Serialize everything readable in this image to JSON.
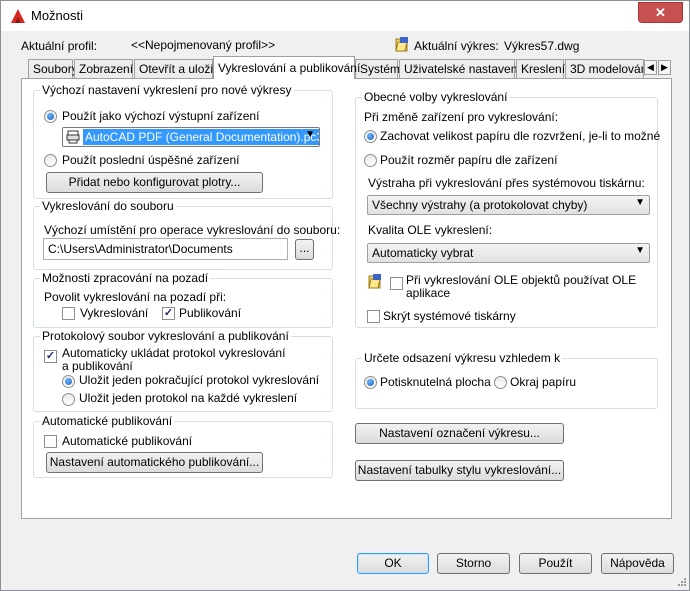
{
  "window": {
    "title": "Možnosti",
    "close_glyph": "✕"
  },
  "profile": {
    "label": "Aktuální profil:",
    "value": "<<Nepojmenovaný profil>>",
    "drawing_label": "Aktuální výkres:",
    "drawing_value": "Výkres57.dwg"
  },
  "tabs": [
    {
      "label": "Soubory"
    },
    {
      "label": "Zobrazení"
    },
    {
      "label": "Otevřít a uložit"
    },
    {
      "label": "Vykreslování a publikování"
    },
    {
      "label": "Systém"
    },
    {
      "label": "Uživatelské nastavení"
    },
    {
      "label": "Kreslení"
    },
    {
      "label": "3D modelování"
    }
  ],
  "tab_scroll": {
    "left": "◀",
    "right": "▶"
  },
  "left": {
    "default_output": {
      "title": "Výchozí nastavení vykreslení pro nové výkresy",
      "use_default_label": "Použít jako výchozí výstupní zařízení",
      "device_value": "AutoCAD PDF (General Documentation).pc3",
      "use_last_label": "Použít poslední úspěšné zařízení",
      "add_plotters_button": "Přidat nebo konfigurovat plotry..."
    },
    "plot_to_file": {
      "title": "Vykreslování do souboru",
      "location_label": "Výchozí umístění pro operace vykreslování do souboru:",
      "path_value": "C:\\Users\\Administrator\\Documents",
      "browse_button": "..."
    },
    "background": {
      "title": "Možnosti zpracování na pozadí",
      "enable_label": "Povolit vykreslování na pozadí při:",
      "plotting_label": "Vykreslování",
      "publishing_label": "Publikování"
    },
    "log": {
      "title": "Protokolový soubor vykreslování a publikování",
      "auto_save_label": "Automaticky ukládat protokol vykreslování a publikování",
      "one_continuous_label": "Uložit jeden pokračující protokol vykreslování",
      "one_per_plot_label": "Uložit jeden protokol na každé vykreslení"
    },
    "auto_publish": {
      "title": "Automatické publikování",
      "checkbox_label": "Automatické publikování",
      "settings_button": "Nastavení automatického publikování..."
    }
  },
  "right": {
    "general": {
      "title": "Obecné volby vykreslování",
      "device_change_label": "Při změně zařízení pro vykreslování:",
      "keep_layout_label": "Zachovat velikost papíru dle rozvržení, je-li to možné",
      "use_device_label": "Použít rozměr papíru dle zařízení",
      "system_alert_label": "Výstraha při vykreslování přes systémovou tiskárnu:",
      "alert_value": "Všechny výstrahy (a protokolovat chyby)",
      "ole_quality_label": "Kvalita OLE vykreslení:",
      "ole_value": "Automaticky vybrat",
      "ole_app_label": "Při vykreslování OLE objektů používat OLE aplikace",
      "hide_printers_label": "Skrýt systémové tiskárny"
    },
    "offset": {
      "title": "Určete odsazení výkresu vzhledem k",
      "printable_label": "Potisknutelná plocha",
      "paper_edge_label": "Okraj papíru"
    },
    "stamp_button": "Nastavení označení výkresu...",
    "plot_style_button": "Nastavení tabulky stylu vykreslování..."
  },
  "footer": {
    "ok": "OK",
    "cancel": "Storno",
    "apply": "Použít",
    "help": "Nápověda"
  },
  "colors": {
    "accent": "#3399ff",
    "close": "#c75050",
    "logo": "#d9261c"
  }
}
